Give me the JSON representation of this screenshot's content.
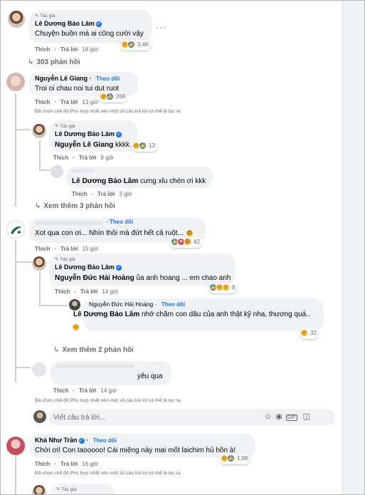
{
  "c1": {
    "author_tag": "Tác giả",
    "name": "Lê Dương Bảo Lâm",
    "text": "Chuyện buồn mà ai cũng cười vậy",
    "like": "Thích",
    "reply": "Trả lời",
    "time": "16 giờ",
    "reactions": "3,4K",
    "view_replies": "303 phản hồi"
  },
  "c2": {
    "name": "Nguyễn Lê Giang",
    "follow": "Theo dõi",
    "text": "Troi oi chau noi tui dut ruot",
    "like": "Thích",
    "reply": "Trả lời",
    "time": "13 giờ",
    "reactions": "268",
    "note": "Đã chọn chế độ Phù hợp nhất nên một số câu trả lời có thể bị lọc ra."
  },
  "r21": {
    "author_tag": "Tác giả",
    "name": "Lê Dương Bảo Lâm",
    "mention": "Nguyễn Lê Giang",
    "text": " kkkk",
    "like": "Thích",
    "reply": "Trả lời",
    "time": "9 giờ",
    "reactions": "13"
  },
  "r22": {
    "mention": "Lê Dương Bảo Lâm",
    "text": " cưng xỉu chèn ơi kkk",
    "like": "Thích",
    "reply": "Trả lời",
    "time": "3 giờ"
  },
  "more1": "Xem thêm 3 phản hồi",
  "c3": {
    "follow": "Theo dõi",
    "text": "Xot qua con ơi... Nhìn thôi mà đứt hết cả ruột...",
    "like": "Thích",
    "reply": "Trả lời",
    "time": "15 giờ",
    "reactions": "42"
  },
  "r31": {
    "author_tag": "Tác giả",
    "name": "Lê Dương Bảo Lâm",
    "mention": "Nguyễn Đức Hải Hoàng",
    "text": " ủa anh hoang ... em chao anh",
    "like": "Thích",
    "reply": "Trả lời",
    "time": "14 giờ",
    "reactions": "8"
  },
  "r32": {
    "name": "Nguyễn Đức Hải Hoàng",
    "follow": "Theo dõi",
    "mention": "Lê Dương Bảo Lâm",
    "text": " nhớ chăm con dâu của anh thật kỹ nha, thương quá..",
    "reactions": "32"
  },
  "more2": "Xem thêm 2 phản hồi",
  "c4": {
    "text": "yêu qua",
    "like": "Thích",
    "reply": "Trả lời",
    "time": "14 giờ",
    "note": "Đã chọn chế độ Phù hợp nhất nên một số câu trả lời có thể bị lọc ra."
  },
  "composer": {
    "placeholder": "Viết câu trả lời..."
  },
  "c5": {
    "name": "Khả Như Trần",
    "follow": "Theo dõi",
    "text": "Chời ơi! Con taooooo! Cái miệng này mai mốt laichim hú hồn à!",
    "like": "Thích",
    "reply": "Trả lời",
    "time": "16 giờ",
    "reactions": "1,8K",
    "note": "Đã chọn chế độ Phù hợp nhất nên một số câu trả lời có thể bị lọc ra."
  },
  "c6": {
    "author_tag": "Tác giả"
  },
  "icons": {
    "pencil": "pencil-icon",
    "verified": "verified-check-icon",
    "reply_arrow": "reply-arrow-icon",
    "more": "more-options-icon",
    "emoji": "emoji-icon",
    "camera": "camera-icon",
    "gif": "gif-icon",
    "sticker": "sticker-icon"
  },
  "colors": {
    "link": "#1877f2",
    "bubble": "#f0f2f5",
    "muted": "#65676b"
  }
}
